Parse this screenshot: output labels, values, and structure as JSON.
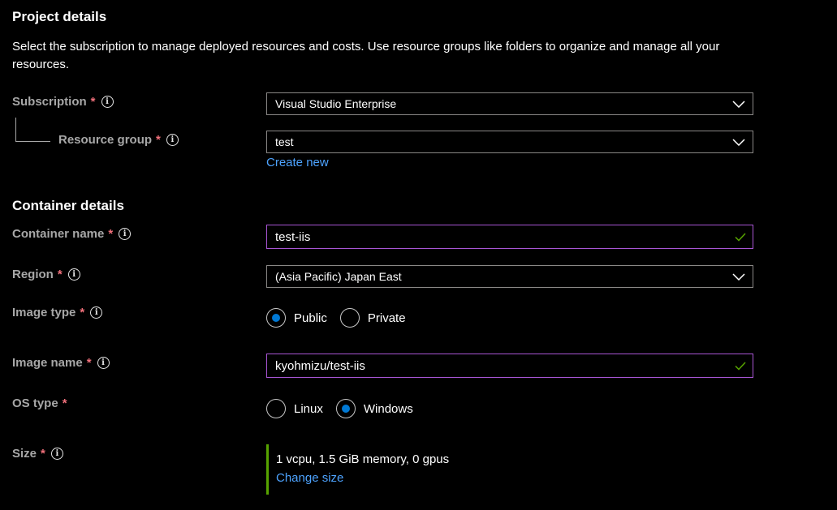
{
  "project_details": {
    "title": "Project details",
    "description": "Select the subscription to manage deployed resources and costs. Use resource groups like folders to organize and manage all your resources.",
    "subscription": {
      "label": "Subscription",
      "required_mark": "*",
      "value": "Visual Studio Enterprise"
    },
    "resource_group": {
      "label": "Resource group",
      "required_mark": "*",
      "value": "test",
      "create_new_link": "Create new"
    }
  },
  "container_details": {
    "title": "Container details",
    "container_name": {
      "label": "Container name",
      "required_mark": "*",
      "value": "test-iis"
    },
    "region": {
      "label": "Region",
      "required_mark": "*",
      "value": "(Asia Pacific) Japan East"
    },
    "image_type": {
      "label": "Image type",
      "required_mark": "*",
      "options": [
        "Public",
        "Private"
      ],
      "selected": "Public"
    },
    "image_name": {
      "label": "Image name",
      "required_mark": "*",
      "value": "kyohmizu/test-iis"
    },
    "os_type": {
      "label": "OS type",
      "required_mark": "*",
      "options": [
        "Linux",
        "Windows"
      ],
      "selected": "Windows"
    },
    "size": {
      "label": "Size",
      "required_mark": "*",
      "value": "1 vcpu, 1.5 GiB memory, 0 gpus",
      "change_link": "Change size"
    }
  },
  "icons": {
    "info": "info-icon",
    "chevron": "chevron-down-icon",
    "check": "checkmark-icon"
  },
  "colors": {
    "background": "#000000",
    "label": "#a7a7a7",
    "required": "#f1707b",
    "link": "#4da3ff",
    "focus_border": "#a855d4",
    "radio_selected": "#0078d4",
    "valid_check": "#57a300"
  }
}
